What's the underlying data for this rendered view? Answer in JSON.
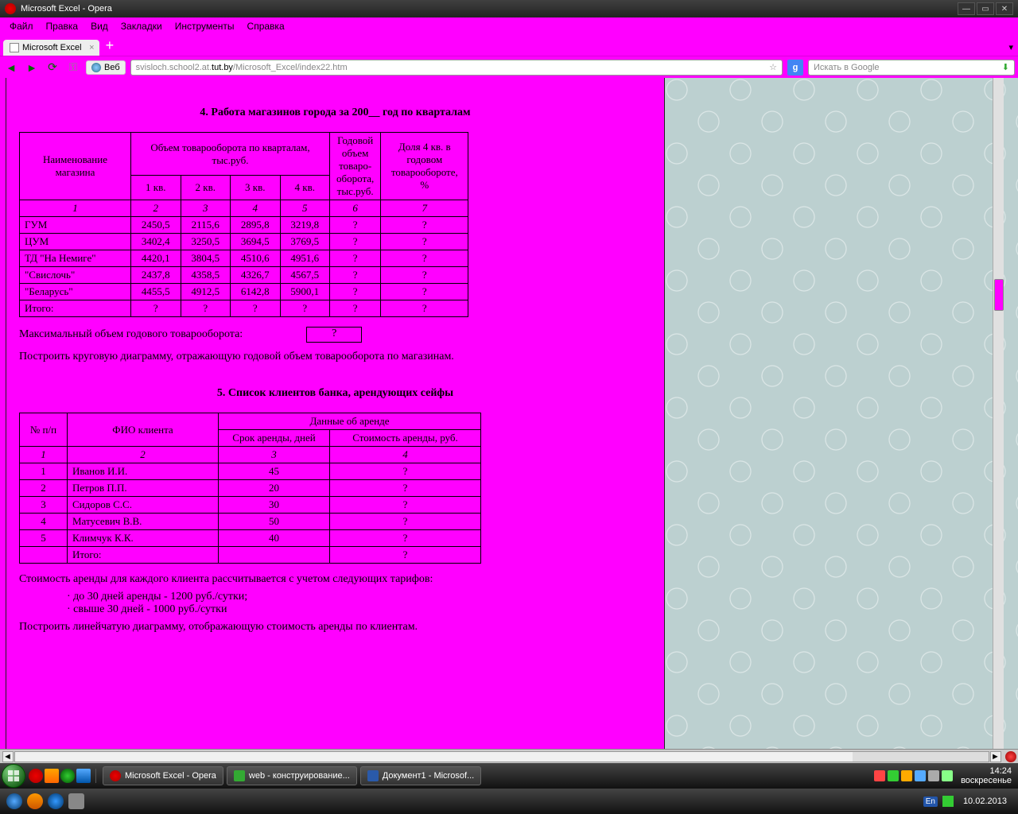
{
  "window": {
    "title": "Microsoft Excel - Opera"
  },
  "menu": {
    "file": "Файл",
    "edit": "Правка",
    "view": "Вид",
    "bookmarks": "Закладки",
    "tools": "Инструменты",
    "help": "Справка"
  },
  "tab": {
    "label": "Microsoft Excel"
  },
  "address": {
    "chip": "Веб",
    "url_grey1": "svisloch.school2.at.",
    "url_bold": "tut.by",
    "url_grey2": "/Microsoft_Excel/index22.htm",
    "search_placeholder": "Искать в Google"
  },
  "section4": {
    "title": "4. Работа магазинов города за 200__ год по кварталам",
    "headers": {
      "name": "Наименование магазина",
      "volume": "Объем товарооборота по кварталам,        тыс.руб.",
      "q1": "1 кв.",
      "q2": "2 кв.",
      "q3": "3 кв.",
      "q4": "4 кв.",
      "annual": "Годовой объем товаро-оборота, тыс.руб.",
      "share": "Доля  4 кв. в годовом товарообороте, %"
    },
    "idx": {
      "c1": "1",
      "c2": "2",
      "c3": "3",
      "c4": "4",
      "c5": "5",
      "c6": "6",
      "c7": "7"
    },
    "rows": [
      {
        "name": "ГУМ",
        "q1": "2450,5",
        "q2": "2115,6",
        "q3": "2895,8",
        "q4": "3219,8",
        "annual": "?",
        "share": "?"
      },
      {
        "name": "ЦУМ",
        "q1": "3402,4",
        "q2": "3250,5",
        "q3": "3694,5",
        "q4": "3769,5",
        "annual": "?",
        "share": "?"
      },
      {
        "name": "ТД \"На Немиге\"",
        "q1": "4420,1",
        "q2": "3804,5",
        "q3": "4510,6",
        "q4": "4951,6",
        "annual": "?",
        "share": "?"
      },
      {
        "name": "\"Свислочь\"",
        "q1": "2437,8",
        "q2": "4358,5",
        "q3": "4326,7",
        "q4": "4567,5",
        "annual": "?",
        "share": "?"
      },
      {
        "name": "\"Беларусь\"",
        "q1": "4455,5",
        "q2": "4912,5",
        "q3": "6142,8",
        "q4": "5900,1",
        "annual": "?",
        "share": "?"
      }
    ],
    "total": {
      "label": "Итого:",
      "q1": "?",
      "q2": "?",
      "q3": "?",
      "q4": "?",
      "annual": "?",
      "share": "?"
    },
    "max_label": "Максимальный  объем годового товарооборота:",
    "max_value": "?",
    "note": "Построить круговую диаграмму, отражающую годовой объем товарооборота по магазинам."
  },
  "section5": {
    "title": "5. Список клиентов банка, арендующих сейфы",
    "headers": {
      "num": "№ п/п",
      "fio": "ФИО клиента",
      "rent": "Данные об аренде",
      "term": "Срок аренды,  дней",
      "cost": "Стоимость аренды,    руб."
    },
    "idx": {
      "c1": "1",
      "c2": "2",
      "c3": "3",
      "c4": "4"
    },
    "rows": [
      {
        "n": "1",
        "fio": "Иванов И.И.",
        "term": "45",
        "cost": "?"
      },
      {
        "n": "2",
        "fio": "Петров П.П.",
        "term": "20",
        "cost": "?"
      },
      {
        "n": "3",
        "fio": "Сидоров С.С.",
        "term": "30",
        "cost": "?"
      },
      {
        "n": "4",
        "fio": "Матусевич В.В.",
        "term": "50",
        "cost": "?"
      },
      {
        "n": "5",
        "fio": "Климчук К.К.",
        "term": "40",
        "cost": "?"
      }
    ],
    "total": {
      "label": "Итого:",
      "cost": "?"
    },
    "note1": "Стоимость аренды  для каждого клиента рассчитывается с учетом следующих тарифов:",
    "b1": "·   до 30 дней аренды - 1200 руб./сутки;",
    "b2": "·   свыше 30 дней - 1000 руб./сутки",
    "note2": "Построить линейчатую диаграмму, отображающую стоимость аренды по клиентам."
  },
  "taskbar": {
    "t1": "Microsoft Excel - Opera",
    "t2": "web - конструирование...",
    "t3": "Документ1 - Microsof...",
    "lang": "En",
    "time": "14:24",
    "date": "10.02.2013",
    "day": "воскресенье"
  }
}
